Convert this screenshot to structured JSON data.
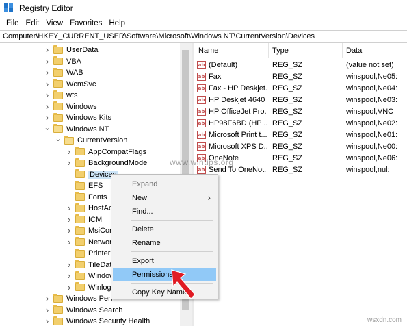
{
  "window": {
    "title": "Registry Editor"
  },
  "menu": [
    "File",
    "Edit",
    "View",
    "Favorites",
    "Help"
  ],
  "address": "Computer\\HKEY_CURRENT_USER\\Software\\Microsoft\\Windows NT\\CurrentVersion\\Devices",
  "tree": [
    {
      "label": "UserData",
      "expander": "collapsed",
      "level": 0
    },
    {
      "label": "VBA",
      "expander": "collapsed",
      "level": 0
    },
    {
      "label": "WAB",
      "expander": "collapsed",
      "level": 0
    },
    {
      "label": "WcmSvc",
      "expander": "collapsed",
      "level": 0
    },
    {
      "label": "wfs",
      "expander": "collapsed",
      "level": 0
    },
    {
      "label": "Windows",
      "expander": "collapsed",
      "level": 0
    },
    {
      "label": "Windows Kits",
      "expander": "collapsed",
      "level": 0
    },
    {
      "label": "Windows NT",
      "expander": "expanded",
      "level": 0
    },
    {
      "label": "CurrentVersion",
      "expander": "expanded",
      "level": 1
    },
    {
      "label": "AppCompatFlags",
      "expander": "collapsed",
      "level": 2
    },
    {
      "label": "BackgroundModel",
      "expander": "collapsed",
      "level": 2
    },
    {
      "label": "Devices",
      "expander": "none",
      "level": 2,
      "selected": true
    },
    {
      "label": "EFS",
      "expander": "none",
      "level": 2
    },
    {
      "label": "Fonts",
      "expander": "none",
      "level": 2
    },
    {
      "label": "HostAct",
      "expander": "collapsed",
      "level": 2
    },
    {
      "label": "ICM",
      "expander": "collapsed",
      "level": 2
    },
    {
      "label": "MsiCorr",
      "expander": "collapsed",
      "level": 2
    },
    {
      "label": "Networ",
      "expander": "collapsed",
      "level": 2
    },
    {
      "label": "PrinterP",
      "expander": "none",
      "level": 2
    },
    {
      "label": "TileData",
      "expander": "collapsed",
      "level": 2
    },
    {
      "label": "Window",
      "expander": "collapsed",
      "level": 2
    },
    {
      "label": "Winlogo",
      "expander": "collapsed",
      "level": 2
    },
    {
      "label": "Windows Perf",
      "expander": "collapsed",
      "level": 0
    },
    {
      "label": "Windows Search",
      "expander": "collapsed",
      "level": 0
    },
    {
      "label": "Windows Security Health",
      "expander": "collapsed",
      "level": 0
    }
  ],
  "list": {
    "columns": [
      "Name",
      "Type",
      "Data"
    ],
    "rows": [
      {
        "name": "(Default)",
        "type": "REG_SZ",
        "data": "(value not set)"
      },
      {
        "name": "Fax",
        "type": "REG_SZ",
        "data": "winspool,Ne05:"
      },
      {
        "name": "Fax - HP Deskjet...",
        "type": "REG_SZ",
        "data": "winspool,Ne04:"
      },
      {
        "name": "HP Deskjet 4640 ...",
        "type": "REG_SZ",
        "data": "winspool,Ne03:"
      },
      {
        "name": "HP OfficeJet Pro...",
        "type": "REG_SZ",
        "data": "winspool,VNC"
      },
      {
        "name": "HP98F6BD (HP ...",
        "type": "REG_SZ",
        "data": "winspool,Ne02:"
      },
      {
        "name": "Microsoft Print t...",
        "type": "REG_SZ",
        "data": "winspool,Ne01:"
      },
      {
        "name": "Microsoft XPS D...",
        "type": "REG_SZ",
        "data": "winspool,Ne00:"
      },
      {
        "name": "OneNote",
        "type": "REG_SZ",
        "data": "winspool,Ne06:"
      },
      {
        "name": "Send To OneNot...",
        "type": "REG_SZ",
        "data": "winspool,nul:"
      }
    ]
  },
  "context_menu": {
    "items": [
      {
        "label": "Expand",
        "disabled": true
      },
      {
        "label": "New",
        "submenu": true
      },
      {
        "label": "Find..."
      },
      {
        "label": "Delete"
      },
      {
        "label": "Rename"
      },
      {
        "label": "Export"
      },
      {
        "label": "Permissions...",
        "highlighted": true
      },
      {
        "label": "Copy Key Name"
      }
    ]
  },
  "watermark": "www.wintips.org",
  "footer": "wsxdn.com",
  "colors": {
    "selection": "#cce4f7",
    "menu_highlight": "#91c9f7",
    "arrow": "#e01b24"
  }
}
